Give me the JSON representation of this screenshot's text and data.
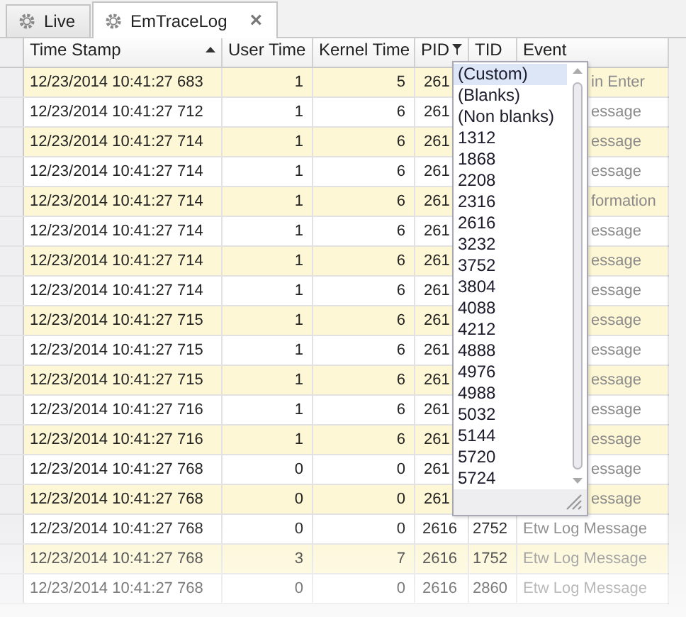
{
  "tabs": [
    {
      "label": "Live",
      "selected": false,
      "closable": false
    },
    {
      "label": "EmTraceLog",
      "selected": true,
      "closable": true,
      "close": "×"
    }
  ],
  "table": {
    "columns": [
      {
        "label": "Time Stamp",
        "sorted": true,
        "filtered": false
      },
      {
        "label": "User Time",
        "sorted": false,
        "filtered": false
      },
      {
        "label": "Kernel Time",
        "sorted": false,
        "filtered": false
      },
      {
        "label": "PID",
        "sorted": false,
        "filtered": true
      },
      {
        "label": "TID",
        "sorted": false,
        "filtered": false
      },
      {
        "label": "Event",
        "sorted": false,
        "filtered": false
      }
    ],
    "rows": [
      {
        "kind": "under_popup",
        "time": "12/23/2014 10:41:27 683",
        "user": "1",
        "kernel": "5",
        "pid": "261",
        "event": "in Enter"
      },
      {
        "kind": "under_popup",
        "time": "12/23/2014 10:41:27 712",
        "user": "1",
        "kernel": "6",
        "pid": "261",
        "event": "essage"
      },
      {
        "kind": "under_popup",
        "time": "12/23/2014 10:41:27 714",
        "user": "1",
        "kernel": "6",
        "pid": "261",
        "event": "essage"
      },
      {
        "kind": "under_popup",
        "time": "12/23/2014 10:41:27 714",
        "user": "1",
        "kernel": "6",
        "pid": "261",
        "event": "essage"
      },
      {
        "kind": "under_popup",
        "time": "12/23/2014 10:41:27 714",
        "user": "1",
        "kernel": "6",
        "pid": "261",
        "event": "formation"
      },
      {
        "kind": "under_popup",
        "time": "12/23/2014 10:41:27 714",
        "user": "1",
        "kernel": "6",
        "pid": "261",
        "event": "essage"
      },
      {
        "kind": "under_popup",
        "time": "12/23/2014 10:41:27 714",
        "user": "1",
        "kernel": "6",
        "pid": "261",
        "event": "essage"
      },
      {
        "kind": "under_popup",
        "time": "12/23/2014 10:41:27 714",
        "user": "1",
        "kernel": "6",
        "pid": "261",
        "event": "essage"
      },
      {
        "kind": "under_popup",
        "time": "12/23/2014 10:41:27 715",
        "user": "1",
        "kernel": "6",
        "pid": "261",
        "event": "essage"
      },
      {
        "kind": "under_popup",
        "time": "12/23/2014 10:41:27 715",
        "user": "1",
        "kernel": "6",
        "pid": "261",
        "event": "essage"
      },
      {
        "kind": "under_popup",
        "time": "12/23/2014 10:41:27 715",
        "user": "1",
        "kernel": "6",
        "pid": "261",
        "event": "essage"
      },
      {
        "kind": "under_popup",
        "time": "12/23/2014 10:41:27 716",
        "user": "1",
        "kernel": "6",
        "pid": "261",
        "event": "essage"
      },
      {
        "kind": "under_popup",
        "time": "12/23/2014 10:41:27 716",
        "user": "1",
        "kernel": "6",
        "pid": "261",
        "event": "essage"
      },
      {
        "kind": "under_popup",
        "time": "12/23/2014 10:41:27 768",
        "user": "0",
        "kernel": "0",
        "pid": "261",
        "event": "essage"
      },
      {
        "kind": "under_popup",
        "time": "12/23/2014 10:41:27 768",
        "user": "0",
        "kernel": "0",
        "pid": "261",
        "event": "essage"
      },
      {
        "kind": "plain",
        "time": "12/23/2014 10:41:27 768",
        "user": "0",
        "kernel": "0",
        "pid": "2616",
        "tid": "2752",
        "event": "Etw Log Message"
      },
      {
        "kind": "plain",
        "time": "12/23/2014 10:41:27 768",
        "user": "3",
        "kernel": "7",
        "pid": "2616",
        "tid": "1752",
        "event": "Etw Log Message"
      },
      {
        "kind": "plain",
        "time": "12/23/2014 10:41:27 768",
        "user": "0",
        "kernel": "0",
        "pid": "2616",
        "tid": "2860",
        "event": "Etw Log Message"
      }
    ]
  },
  "filter_popup": {
    "items": [
      {
        "label": "(Custom)",
        "selected": true
      },
      {
        "label": "(Blanks)",
        "selected": false
      },
      {
        "label": "(Non blanks)",
        "selected": false
      },
      {
        "label": "1312",
        "selected": false
      },
      {
        "label": "1868",
        "selected": false
      },
      {
        "label": "2208",
        "selected": false
      },
      {
        "label": "2316",
        "selected": false
      },
      {
        "label": "2616",
        "selected": false
      },
      {
        "label": "3232",
        "selected": false
      },
      {
        "label": "3752",
        "selected": false
      },
      {
        "label": "3804",
        "selected": false
      },
      {
        "label": "4088",
        "selected": false
      },
      {
        "label": "4212",
        "selected": false
      },
      {
        "label": "4888",
        "selected": false
      },
      {
        "label": "4976",
        "selected": false
      },
      {
        "label": "4988",
        "selected": false
      },
      {
        "label": "5032",
        "selected": false
      },
      {
        "label": "5144",
        "selected": false
      },
      {
        "label": "5720",
        "selected": false
      },
      {
        "label": "5724",
        "selected": false
      }
    ]
  }
}
